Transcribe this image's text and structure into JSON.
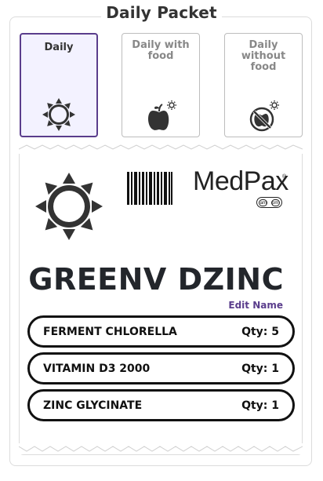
{
  "header": {
    "title": "Daily Packet"
  },
  "options": [
    {
      "label": "Daily",
      "icon": "sun-icon",
      "selected": true
    },
    {
      "label": "Daily with food",
      "icon": "apple-icon",
      "selected": false
    },
    {
      "label": "Daily without food",
      "icon": "no-food-icon",
      "selected": false
    }
  ],
  "packet": {
    "icon": "sun-icon",
    "barcode_icon": "barcode-icon",
    "brand": "MedPax",
    "brand_mark": "®",
    "ampm": {
      "am": "am",
      "pm": "pm"
    },
    "name": "GREENV DZINC",
    "edit_label": "Edit Name",
    "items": [
      {
        "name": "FERMENT CHLORELLA",
        "qty": "Qty: 5"
      },
      {
        "name": "VITAMIN D3 2000",
        "qty": "Qty: 1"
      },
      {
        "name": "ZINC GLYCINATE",
        "qty": "Qty: 1"
      }
    ]
  },
  "colors": {
    "accent": "#5a3d8c",
    "selected_bg": "#f3f2ff",
    "icon_dark": "#333333"
  }
}
